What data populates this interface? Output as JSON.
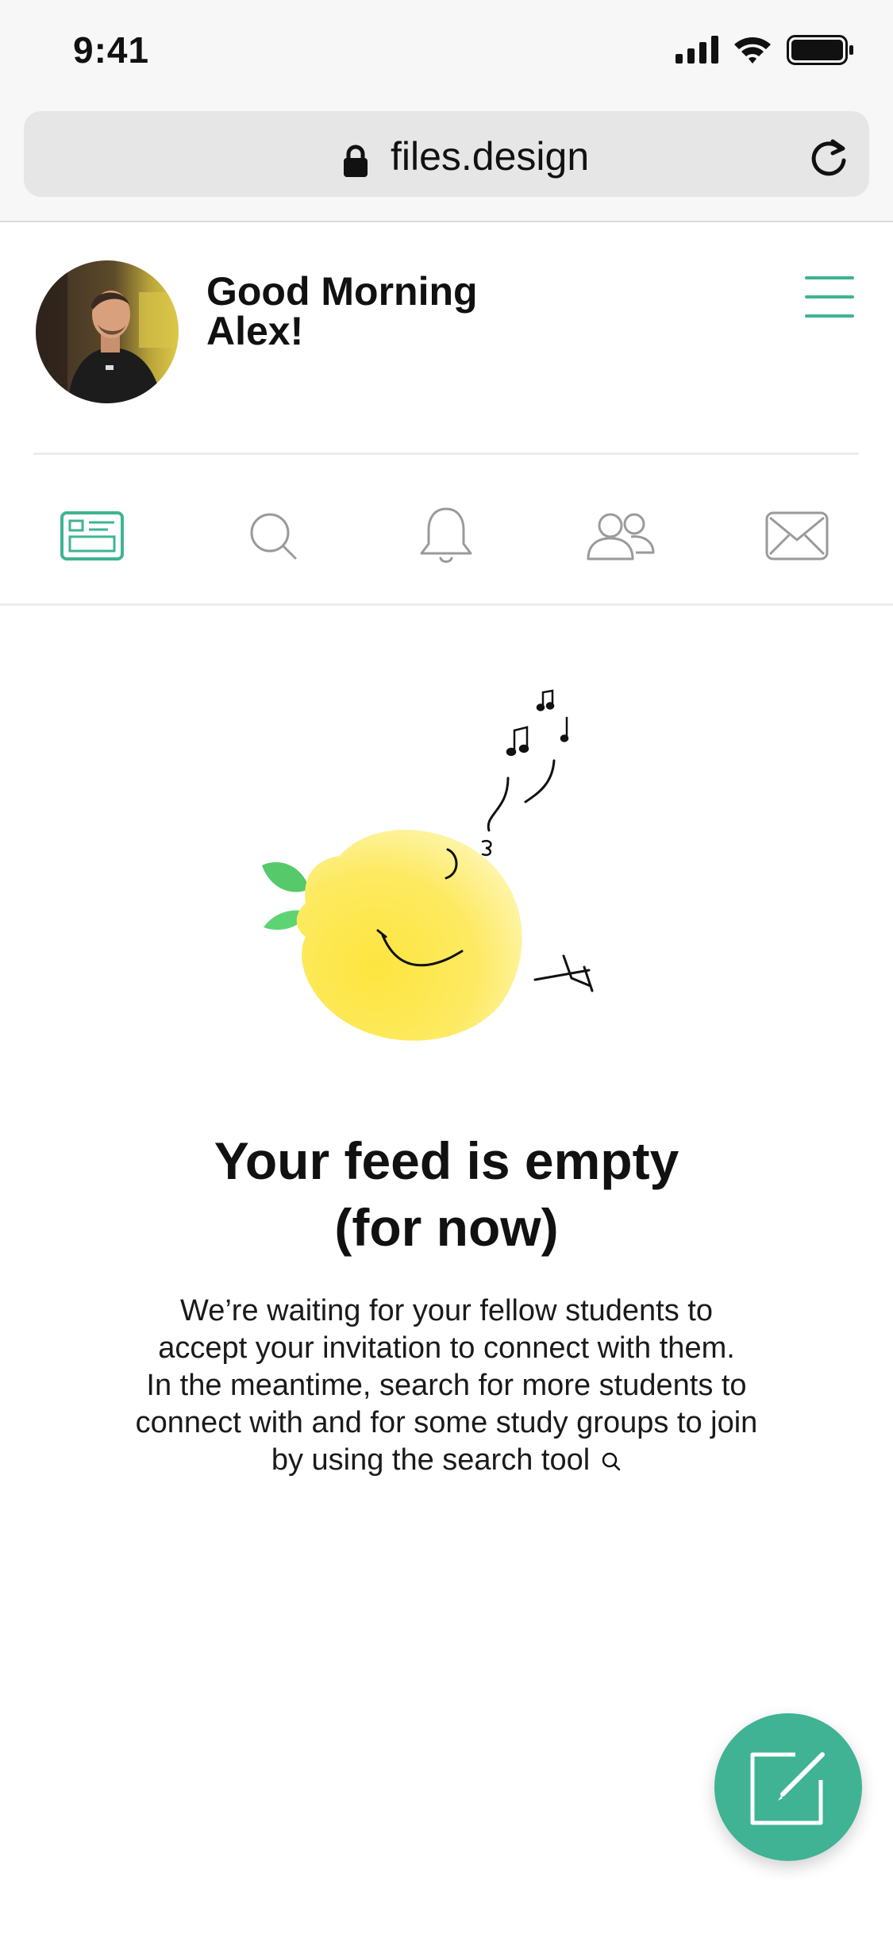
{
  "status_bar": {
    "time": "9:41"
  },
  "browser": {
    "url": "files.design"
  },
  "header": {
    "greeting_line1": "Good Morning",
    "greeting_line2": "Alex!"
  },
  "tabs": [
    {
      "name": "feed",
      "icon": "feed-icon",
      "active": true
    },
    {
      "name": "search",
      "icon": "search-icon",
      "active": false
    },
    {
      "name": "notifications",
      "icon": "bell-icon",
      "active": false
    },
    {
      "name": "people",
      "icon": "people-icon",
      "active": false
    },
    {
      "name": "messages",
      "icon": "mail-icon",
      "active": false
    }
  ],
  "empty_state": {
    "title_line1": "Your feed is empty",
    "title_line2": "(for now)",
    "desc_line1": "We’re waiting for your fellow students to",
    "desc_line2": "accept your invitation to connect with them.",
    "desc_line3": "In the meantime, search for more students to",
    "desc_line4": "connect with and for some study groups to join",
    "desc_line5": "by using the search tool"
  },
  "colors": {
    "accent": "#3fb394",
    "inactive_icon": "#9a9a9a",
    "lemon": "#fde64a",
    "leaf": "#5ccf6e"
  }
}
